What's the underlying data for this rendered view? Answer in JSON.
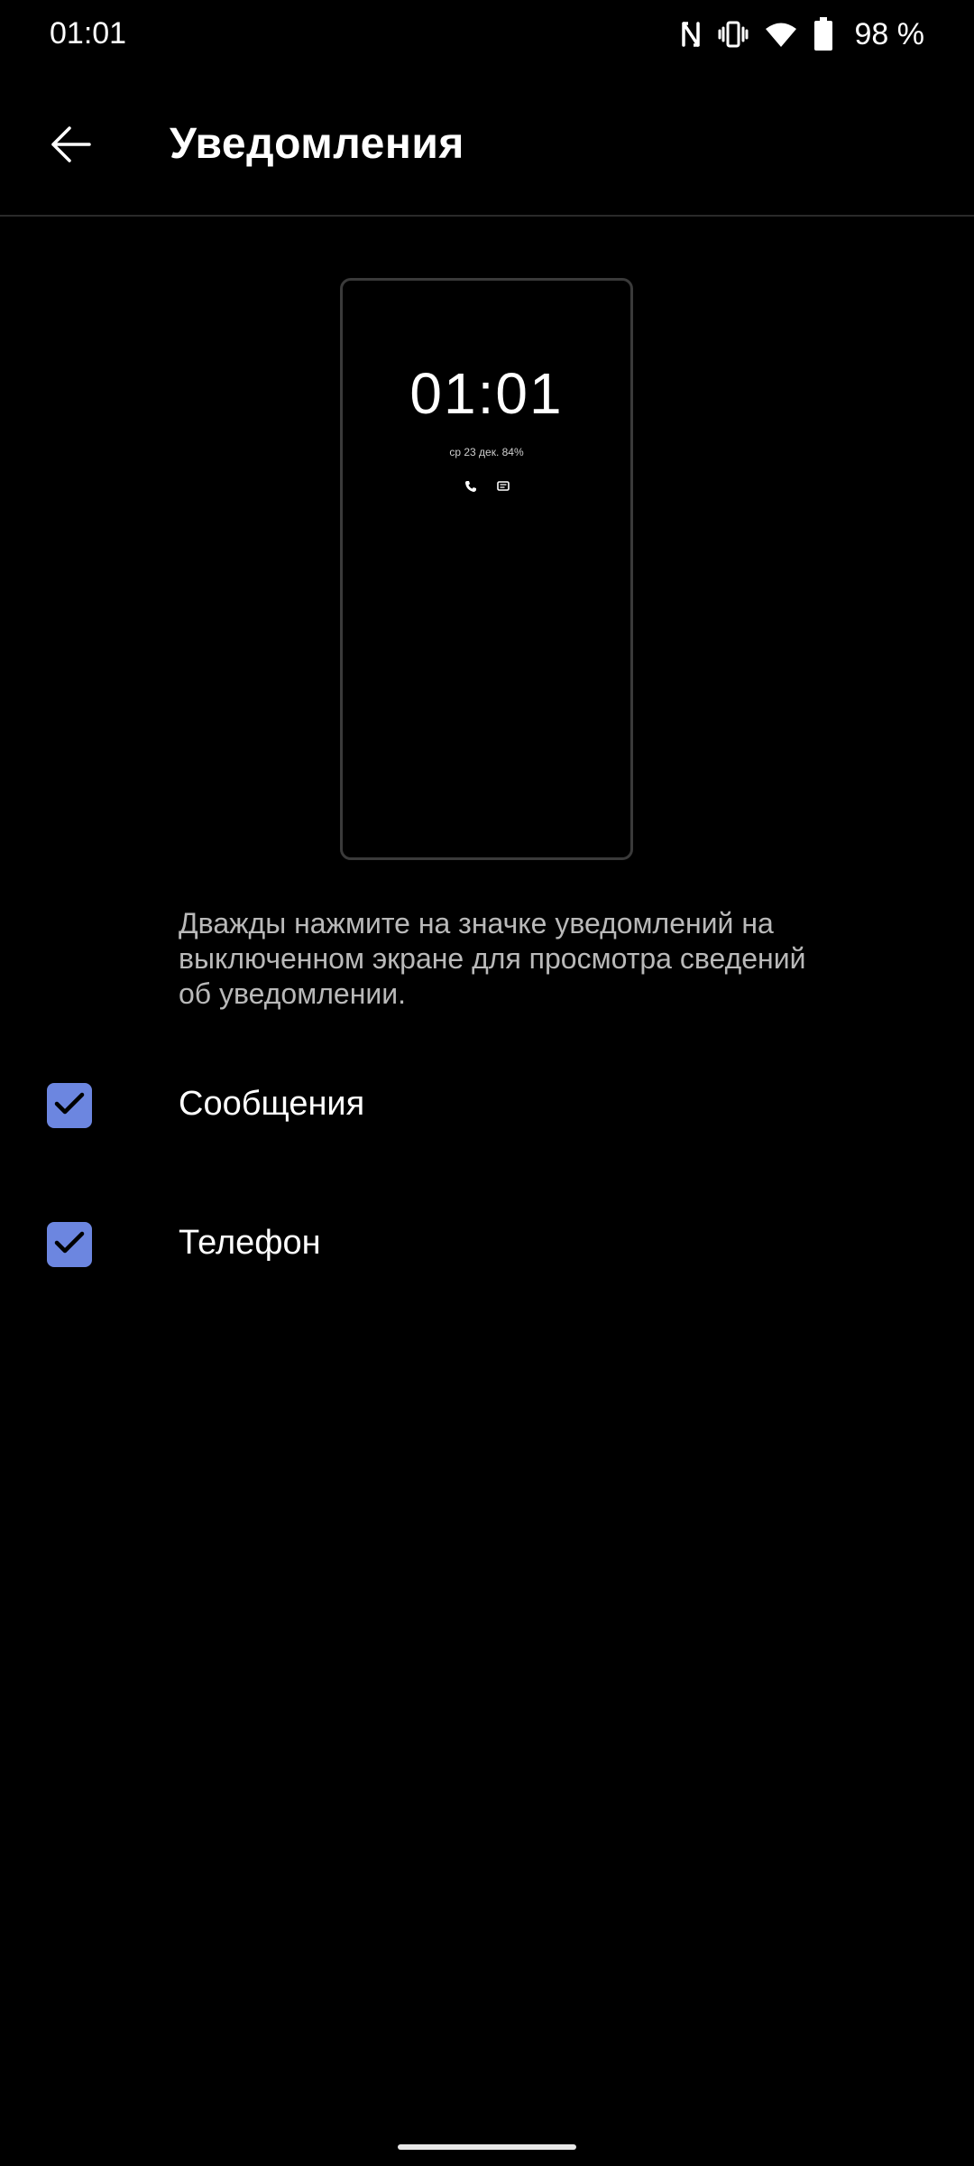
{
  "status_bar": {
    "time": "01:01",
    "battery_percent": "98 %",
    "icons": [
      "nfc-icon",
      "vibrate-icon",
      "wifi-icon",
      "battery-icon"
    ]
  },
  "app_bar": {
    "title": "Уведомления",
    "back_icon": "arrow-left-icon"
  },
  "preview": {
    "time": "01:01",
    "date_battery": "ср 23 дек. 84%",
    "icons": [
      "phone-icon",
      "message-icon"
    ]
  },
  "description": "Дважды нажмите на значке уведомлений на выключенном экране для просмотра сведений об уведомлении.",
  "options": [
    {
      "label": "Сообщения",
      "checked": true
    },
    {
      "label": "Телефон",
      "checked": true
    }
  ],
  "colors": {
    "background": "#000000",
    "accent": "#6c86e0",
    "description_text": "#b9b9b9"
  }
}
